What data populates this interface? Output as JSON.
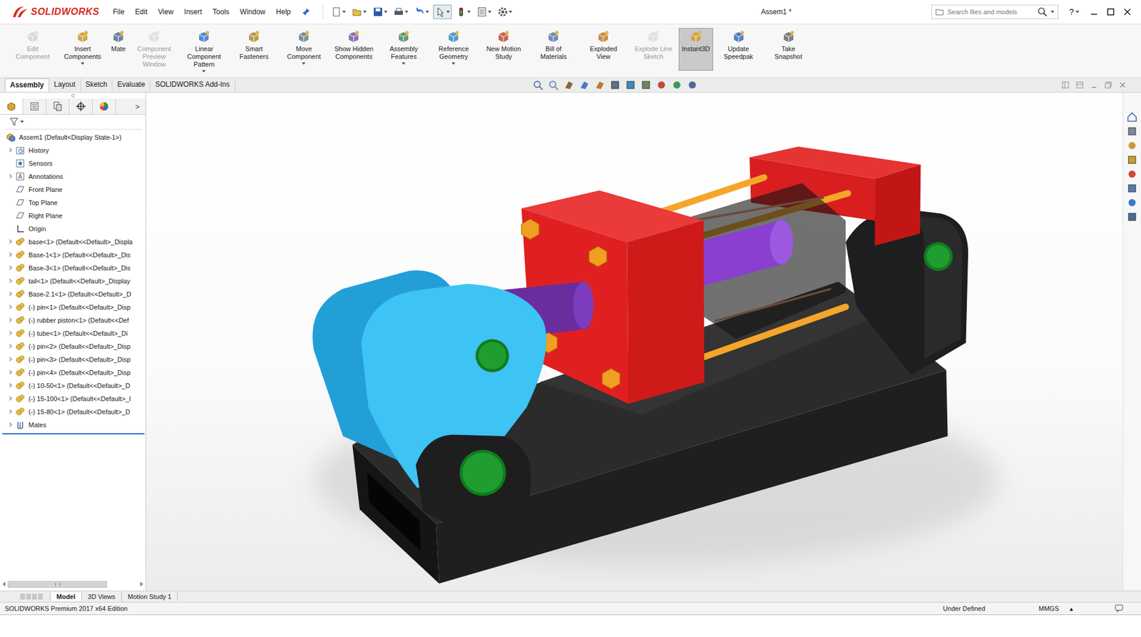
{
  "app": {
    "logo": "SOLIDWORKS",
    "title": "Assem1 *"
  },
  "menus": [
    "File",
    "Edit",
    "View",
    "Insert",
    "Tools",
    "Window",
    "Help"
  ],
  "search": {
    "placeholder": "Search files and models"
  },
  "help": "?",
  "ribbon": [
    {
      "label": "Edit Component",
      "disabled": true,
      "selected": false,
      "dropdown": false
    },
    {
      "label": "Insert Components",
      "disabled": false,
      "selected": false,
      "dropdown": true
    },
    {
      "label": "Mate",
      "disabled": false,
      "selected": false,
      "dropdown": false
    },
    {
      "label": "Component Preview Window",
      "disabled": true,
      "selected": false,
      "dropdown": false
    },
    {
      "label": "Linear Component Pattern",
      "disabled": false,
      "selected": false,
      "dropdown": true
    },
    {
      "label": "Smart Fasteners",
      "disabled": false,
      "selected": false,
      "dropdown": false
    },
    {
      "label": "Move Component",
      "disabled": false,
      "selected": false,
      "dropdown": true
    },
    {
      "label": "Show Hidden Components",
      "disabled": false,
      "selected": false,
      "dropdown": false
    },
    {
      "label": "Assembly Features",
      "disabled": false,
      "selected": false,
      "dropdown": true
    },
    {
      "label": "Reference Geometry",
      "disabled": false,
      "selected": false,
      "dropdown": true
    },
    {
      "label": "New Motion Study",
      "disabled": false,
      "selected": false,
      "dropdown": false
    },
    {
      "label": "Bill of Materials",
      "disabled": false,
      "selected": false,
      "dropdown": false
    },
    {
      "label": "Exploded View",
      "disabled": false,
      "selected": false,
      "dropdown": false
    },
    {
      "label": "Explode Line Sketch",
      "disabled": true,
      "selected": false,
      "dropdown": false
    },
    {
      "label": "Instant3D",
      "disabled": false,
      "selected": true,
      "dropdown": false
    },
    {
      "label": "Update Speedpak",
      "disabled": false,
      "selected": false,
      "dropdown": false
    },
    {
      "label": "Take Snapshot",
      "disabled": false,
      "selected": false,
      "dropdown": false
    }
  ],
  "commandTabs": [
    {
      "label": "Assembly",
      "selected": true
    },
    {
      "label": "Layout",
      "selected": false
    },
    {
      "label": "Sketch",
      "selected": false
    },
    {
      "label": "Evaluate",
      "selected": false
    },
    {
      "label": "SOLIDWORKS Add-Ins",
      "selected": false
    }
  ],
  "panelTabs": {
    "more": ">"
  },
  "tree": {
    "root": "Assem1 (Default<Display State-1>)",
    "items": [
      {
        "label": "History",
        "kind": "history",
        "expandable": true
      },
      {
        "label": "Sensors",
        "kind": "sensor",
        "expandable": false
      },
      {
        "label": "Annotations",
        "kind": "annotation",
        "expandable": true
      },
      {
        "label": "Front Plane",
        "kind": "plane",
        "expandable": false
      },
      {
        "label": "Top Plane",
        "kind": "plane",
        "expandable": false
      },
      {
        "label": "Right Plane",
        "kind": "plane",
        "expandable": false
      },
      {
        "label": "Origin",
        "kind": "origin",
        "expandable": false
      },
      {
        "label": "base<1> (Default<<Default>_Displa",
        "kind": "part",
        "expandable": true
      },
      {
        "label": "Base-1<1> (Default<<Default>_Dis",
        "kind": "part",
        "expandable": true
      },
      {
        "label": "Base-3<1> (Default<<Default>_Dis",
        "kind": "part",
        "expandable": true
      },
      {
        "label": "tail<1> (Default<<Default>_Display",
        "kind": "part",
        "expandable": true
      },
      {
        "label": "Base-2.1<1> (Default<<Default>_D",
        "kind": "part",
        "expandable": true
      },
      {
        "label": "(-) pin<1> (Default<<Default>_Disp",
        "kind": "part",
        "expandable": true
      },
      {
        "label": "(-) rubber piston<1> (Default<<Def",
        "kind": "part",
        "expandable": true
      },
      {
        "label": "(-) tube<1> (Default<<Default>_Di",
        "kind": "part",
        "expandable": true
      },
      {
        "label": "(-) pin<2> (Default<<Default>_Disp",
        "kind": "part",
        "expandable": true
      },
      {
        "label": "(-) pin<3> (Default<<Default>_Disp",
        "kind": "part",
        "expandable": true
      },
      {
        "label": "(-) pin<4> (Default<<Default>_Disp",
        "kind": "part",
        "expandable": true
      },
      {
        "label": "(-) 10-50<1> (Default<<Default>_D",
        "kind": "part",
        "expandable": true
      },
      {
        "label": "(-) 15-100<1> (Default<<Default>_I",
        "kind": "part",
        "expandable": true
      },
      {
        "label": "(-) 15-80<1> (Default<<Default>_D",
        "kind": "part",
        "expandable": true
      },
      {
        "label": "Mates",
        "kind": "mates",
        "expandable": true
      }
    ]
  },
  "bottomTabs": [
    {
      "label": "Model",
      "selected": true
    },
    {
      "label": "3D Views",
      "selected": false
    },
    {
      "label": "Motion Study 1",
      "selected": false
    }
  ],
  "status": {
    "edition": "SOLIDWORKS Premium 2017 x64 Edition",
    "state": "Under Defined",
    "units": "MMGS",
    "unitsArrow": "▴"
  }
}
